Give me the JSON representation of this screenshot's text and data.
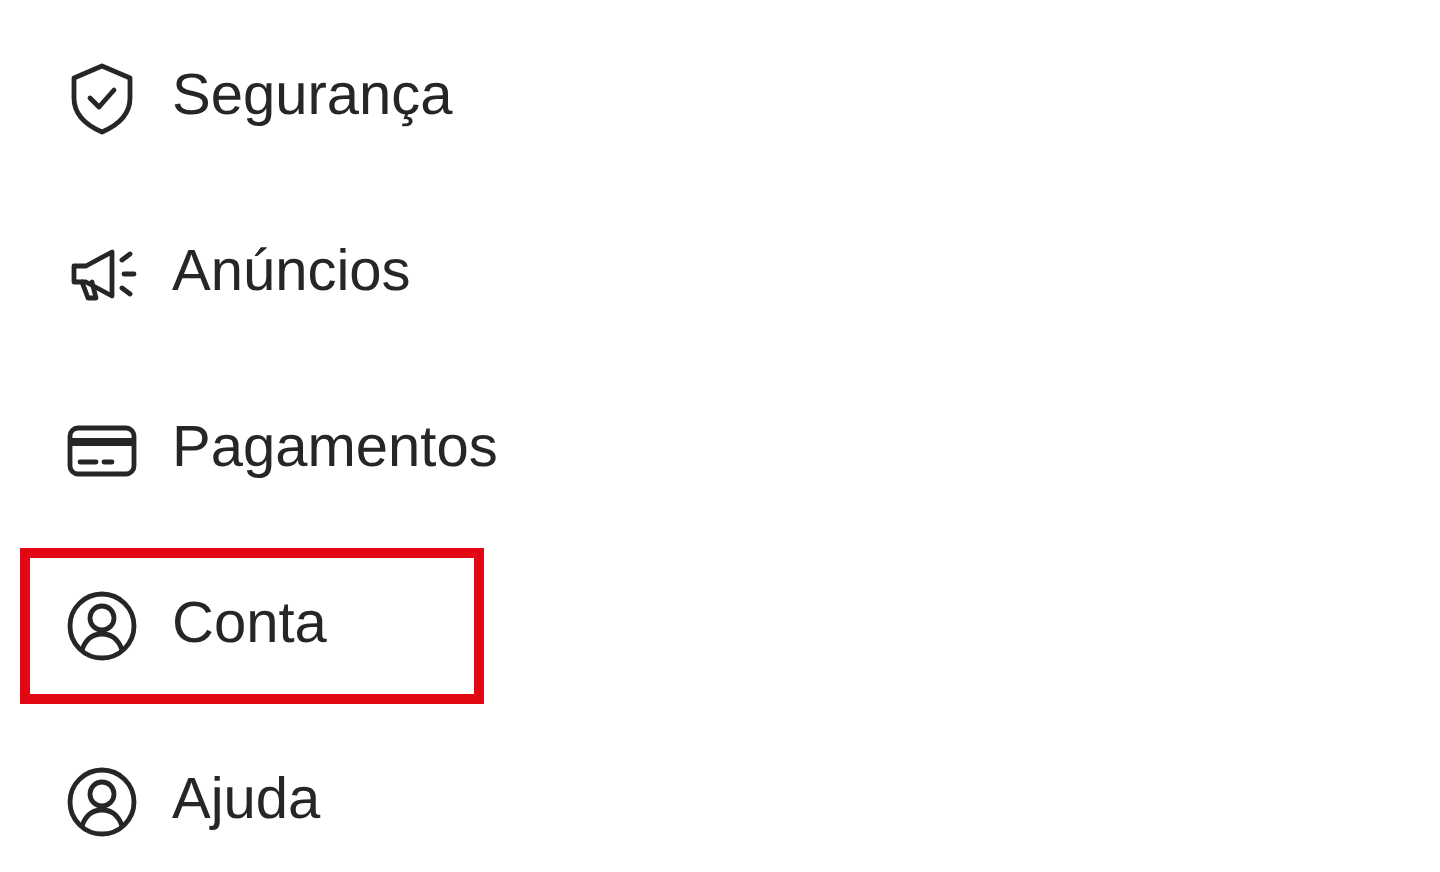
{
  "menu": {
    "items": [
      {
        "label": "Segurança",
        "kind": "shield",
        "highlighted": false
      },
      {
        "label": "Anúncios",
        "kind": "megaphone",
        "highlighted": false
      },
      {
        "label": "Pagamentos",
        "kind": "card",
        "highlighted": false
      },
      {
        "label": "Conta",
        "kind": "account",
        "highlighted": true
      },
      {
        "label": "Ajuda",
        "kind": "account",
        "highlighted": false
      }
    ]
  }
}
